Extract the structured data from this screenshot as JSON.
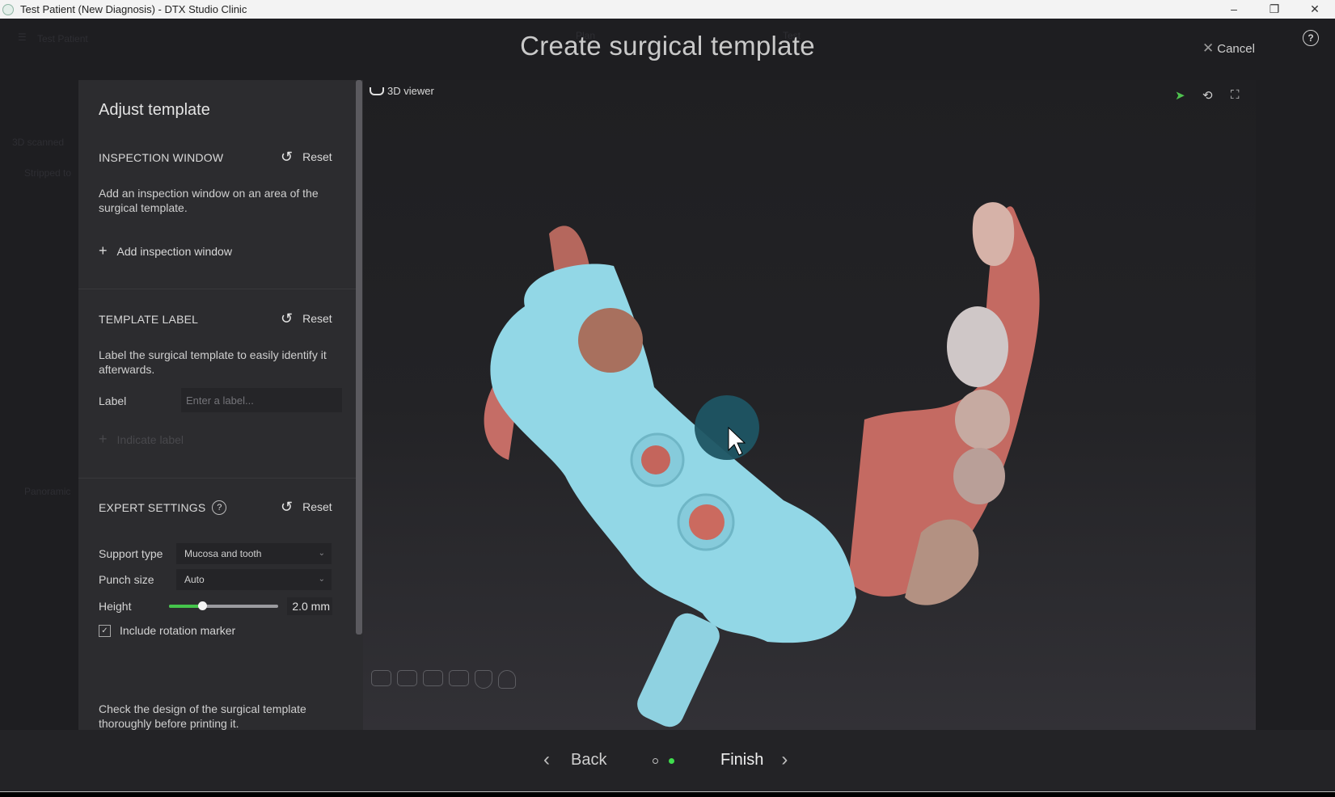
{
  "window": {
    "title": "Test Patient (New Diagnosis) - DTX Studio Clinic",
    "controls": [
      "–",
      "❐",
      "✕"
    ]
  },
  "background": {
    "patient": "Test Patient",
    "faint_items": [
      "3D scanned",
      "Stripped to",
      "Panoramic",
      "Plan",
      "Test"
    ]
  },
  "header": {
    "title": "Create surgical template",
    "cancel_label": "Cancel",
    "cancel_icon": "close-icon",
    "help_icon": "?"
  },
  "panel": {
    "title": "Adjust template",
    "inspection": {
      "heading": "INSPECTION WINDOW",
      "reset_label": "Reset",
      "description": "Add an inspection window on an area of the surgical template.",
      "add_label": "Add inspection window"
    },
    "template_label": {
      "heading": "TEMPLATE LABEL",
      "reset_label": "Reset",
      "description": "Label the surgical template to easily identify it afterwards.",
      "label_field": "Label",
      "label_value": "",
      "label_placeholder": "Enter a label...",
      "indicate_label": "Indicate label"
    },
    "expert": {
      "heading": "EXPERT SETTINGS",
      "reset_label": "Reset",
      "support_type_label": "Support type",
      "support_type_value": "Mucosa and tooth",
      "punch_size_label": "Punch size",
      "punch_size_value": "Auto",
      "height_label": "Height",
      "height_value": "2.0  mm",
      "height_fraction": 0.3,
      "rotation_marker_label": "Include rotation marker",
      "rotation_marker_checked": true
    },
    "footer_note": "Check the design of the surgical template thoroughly before printing it."
  },
  "viewer": {
    "label": "3D viewer",
    "tools": [
      "select-tool",
      "rotate-tool",
      "fit-to-screen"
    ],
    "active_color": "#4fc24f",
    "view_presets": [
      "front",
      "front-open",
      "left",
      "right",
      "lower",
      "upper"
    ]
  },
  "navigation": {
    "back_label": "Back",
    "finish_label": "Finish",
    "steps_total": 2,
    "current_step": 2,
    "accent": "#3fdd4d"
  }
}
